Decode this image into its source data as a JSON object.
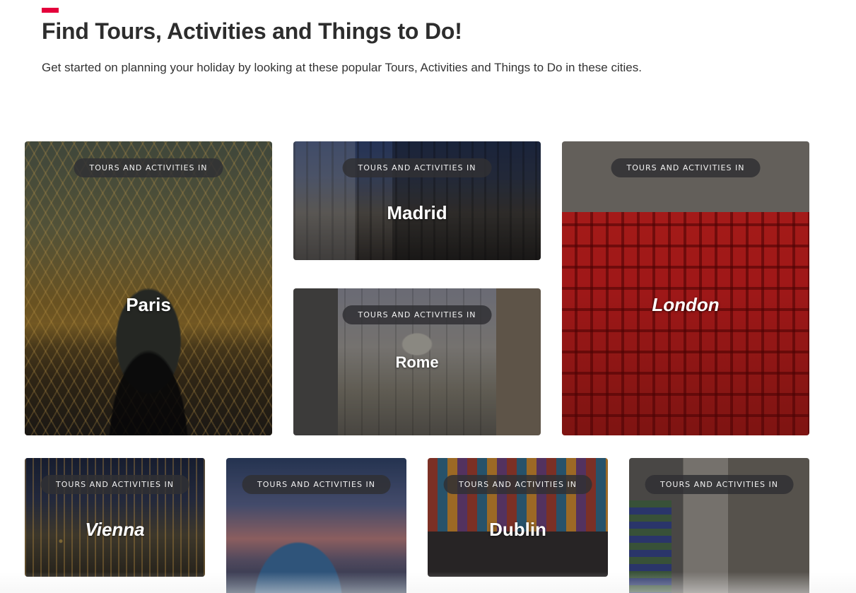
{
  "header": {
    "title": "Find Tours, Activities and Things to Do!",
    "subtitle": "Get started on planning your holiday by looking at these popular Tours, Activities and Things to Do in these cities."
  },
  "colors": {
    "accent": "#e4003b",
    "pill_bg": "#303034",
    "title_text": "#2d2d2d"
  },
  "cards": [
    {
      "tag": "TOURS AND ACTIVITIES IN",
      "city": "Paris"
    },
    {
      "tag": "TOURS AND ACTIVITIES IN",
      "city": "Madrid"
    },
    {
      "tag": "TOURS AND ACTIVITIES IN",
      "city": "Rome"
    },
    {
      "tag": "TOURS AND ACTIVITIES IN",
      "city": "London"
    },
    {
      "tag": "TOURS AND ACTIVITIES IN",
      "city": "Vienna"
    },
    {
      "tag": "TOURS AND ACTIVITIES IN",
      "city": ""
    },
    {
      "tag": "TOURS AND ACTIVITIES IN",
      "city": "Dublin"
    },
    {
      "tag": "TOURS AND ACTIVITIES IN",
      "city": ""
    }
  ]
}
